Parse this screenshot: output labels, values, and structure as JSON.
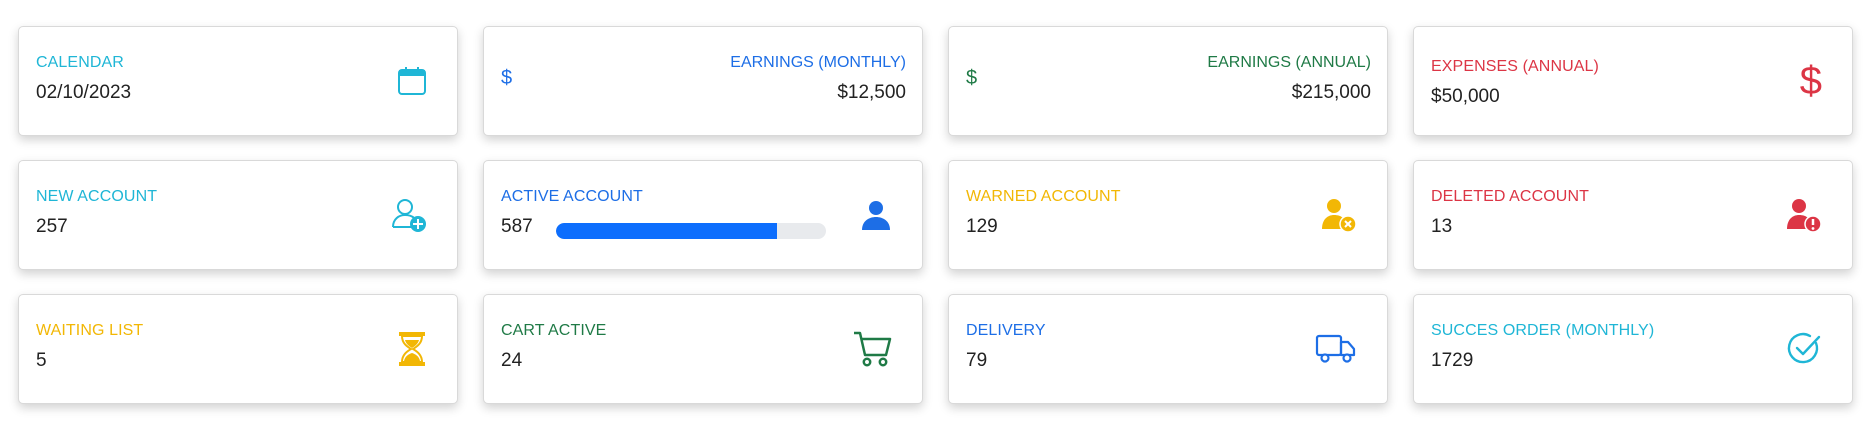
{
  "cards": [
    {
      "label": "CALENDAR",
      "value": "02/10/2023",
      "icon": "calendar-icon",
      "color": "#1fb6d6"
    },
    {
      "label": "EARNINGS (MONTHLY)",
      "value": "$12,500",
      "icon": "dollar-icon",
      "icon_text": "$",
      "color": "#1d6ee6"
    },
    {
      "label": "EARNINGS (ANNUAL)",
      "value": "$215,000",
      "icon": "dollar-icon",
      "icon_text": "$",
      "color": "#1f7a46"
    },
    {
      "label": "EXPENSES (ANNUAL)",
      "value": "$50,000",
      "icon": "dollar-icon",
      "icon_text": "$",
      "color": "#dc3545"
    },
    {
      "label": "NEW ACCOUNT",
      "value": "257",
      "icon": "user-plus-icon",
      "color": "#1fb6d6"
    },
    {
      "label": "ACTIVE ACCOUNT",
      "value": "587",
      "icon": "user-icon",
      "color": "#1d6ee6",
      "progress": 0.82
    },
    {
      "label": "WARNED ACCOUNT",
      "value": "129",
      "icon": "user-x-icon",
      "color": "#f2b705"
    },
    {
      "label": "DELETED ACCOUNT",
      "value": "13",
      "icon": "user-alert-icon",
      "color": "#dc3545"
    },
    {
      "label": "WAITING LIST",
      "value": "5",
      "icon": "hourglass-icon",
      "color": "#f2b705"
    },
    {
      "label": "CART ACTIVE",
      "value": "24",
      "icon": "cart-icon",
      "color": "#1f7a46"
    },
    {
      "label": "DELIVERY",
      "value": "79",
      "icon": "truck-icon",
      "color": "#1d6ee6"
    },
    {
      "label": "SUCCES ORDER (MONTHLY)",
      "value": "1729",
      "icon": "check-circle-icon",
      "color": "#1fb6d6"
    }
  ]
}
